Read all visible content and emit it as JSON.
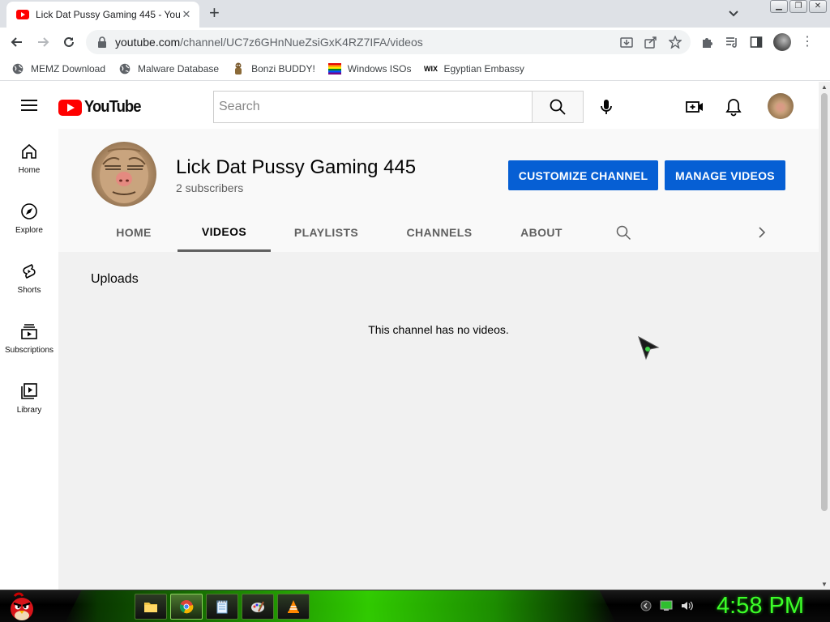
{
  "browser": {
    "tab_title": "Lick Dat Pussy Gaming 445 - You",
    "new_tab_symbol": "+",
    "url_host": "youtube.com",
    "url_path": "/channel/UC7z6GHnNueZsiGxK4RZ7IFA/videos",
    "window_controls": [
      "minimize",
      "restore",
      "close"
    ]
  },
  "bookmarks": [
    {
      "label": "MEMZ Download",
      "icon": "globe-icon"
    },
    {
      "label": "Malware Database",
      "icon": "globe-icon"
    },
    {
      "label": "Bonzi BUDDY!",
      "icon": "bonzi-icon"
    },
    {
      "label": "Windows ISOs",
      "icon": "rainbow-flag-icon"
    },
    {
      "label": "Egyptian Embassy",
      "icon": "wix-icon",
      "icon_text": "WIX"
    }
  ],
  "youtube": {
    "logo_text": "YouTube",
    "search_placeholder": "Search",
    "guide": [
      {
        "label": "Home",
        "icon": "home-icon"
      },
      {
        "label": "Explore",
        "icon": "compass-icon"
      },
      {
        "label": "Shorts",
        "icon": "shorts-icon"
      },
      {
        "label": "Subscriptions",
        "icon": "subscriptions-icon"
      },
      {
        "label": "Library",
        "icon": "library-icon"
      }
    ],
    "channel": {
      "name": "Lick Dat Pussy Gaming 445",
      "subscribers": "2 subscribers",
      "customize_label": "CUSTOMIZE CHANNEL",
      "manage_label": "MANAGE VIDEOS"
    },
    "tabs": [
      "HOME",
      "VIDEOS",
      "PLAYLISTS",
      "CHANNELS",
      "ABOUT"
    ],
    "active_tab": "VIDEOS",
    "section_title": "Uploads",
    "empty_message": "This channel has no videos."
  },
  "taskbar": {
    "clock": "4:58 PM",
    "apps": [
      "file-explorer-icon",
      "chrome-icon",
      "notepad-icon",
      "paint-icon",
      "vlc-icon"
    ],
    "active_app": "chrome-icon"
  },
  "colors": {
    "accent_blue": "#065fd4",
    "youtube_red": "#ff0000",
    "clock_green": "#3cff28"
  }
}
